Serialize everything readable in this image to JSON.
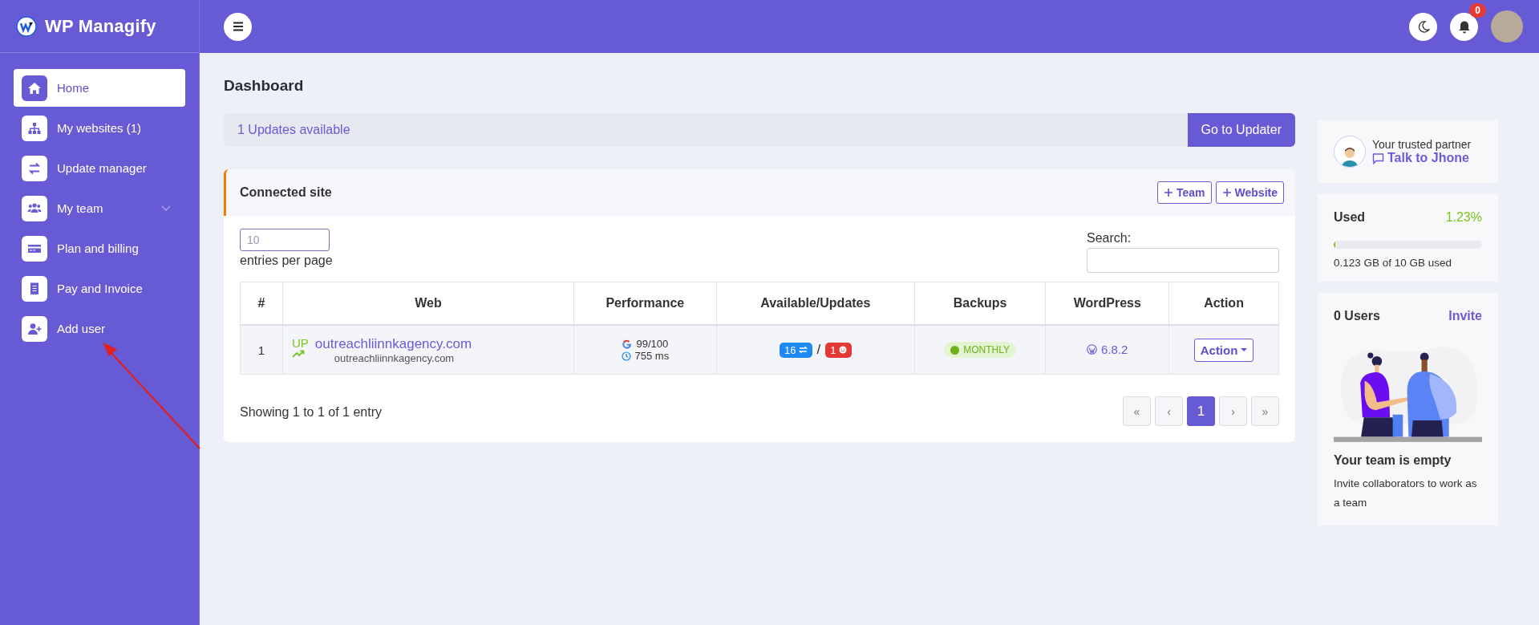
{
  "brand": {
    "name": "WP Managify"
  },
  "header": {
    "notification_count": "0"
  },
  "sidebar": {
    "items": [
      {
        "label": "Home",
        "selected": true,
        "has_submenu": false
      },
      {
        "label": "My websites (1)",
        "selected": false,
        "has_submenu": false
      },
      {
        "label": "Update manager",
        "selected": false,
        "has_submenu": false
      },
      {
        "label": "My team",
        "selected": false,
        "has_submenu": true
      },
      {
        "label": "Plan and billing",
        "selected": false,
        "has_submenu": false
      },
      {
        "label": "Pay and Invoice",
        "selected": false,
        "has_submenu": false
      },
      {
        "label": "Add user",
        "selected": false,
        "has_submenu": false
      }
    ]
  },
  "page_title": "Dashboard",
  "updates_banner": {
    "text": "1 Updates available",
    "button": "Go to Updater"
  },
  "connected_site": {
    "title": "Connected site",
    "buttons": [
      "Team",
      "Website"
    ],
    "entries": {
      "value": "10",
      "label": "entries per page"
    },
    "search": {
      "label": "Search:"
    },
    "table": {
      "columns": [
        "#",
        "Web",
        "Performance",
        "Available/Updates",
        "Backups",
        "WordPress",
        "Action"
      ],
      "rows": [
        {
          "number": "1",
          "status": "UP",
          "site": "outreachliinnkagency.com",
          "site_subtitle": "outreachliinnkagency.com",
          "pagespeed": "99/100",
          "load_time": "755 ms",
          "available": "16",
          "separator": "/",
          "updates": "1",
          "backup": "MONTHLY",
          "wordpress": "6.8.2",
          "action": "Action"
        }
      ]
    },
    "footer": "Showing 1 to 1 of 1 entry",
    "pagination": [
      {
        "label": "«",
        "selected": false
      },
      {
        "label": "‹",
        "selected": false
      },
      {
        "label": "1",
        "selected": true
      },
      {
        "label": "›",
        "selected": false
      },
      {
        "label": "»",
        "selected": false
      }
    ]
  },
  "partner": {
    "caption": "Your trusted partner",
    "link": "Talk to Jhone"
  },
  "usage": {
    "title": "Used",
    "percent": "1.23%",
    "level": 0.0123,
    "detail": "0.123 GB of 10 GB used"
  },
  "team": {
    "title": "0 Users",
    "action": "Invite",
    "heading": "Your team is empty",
    "text": "Invite collaborators to work as a team"
  }
}
